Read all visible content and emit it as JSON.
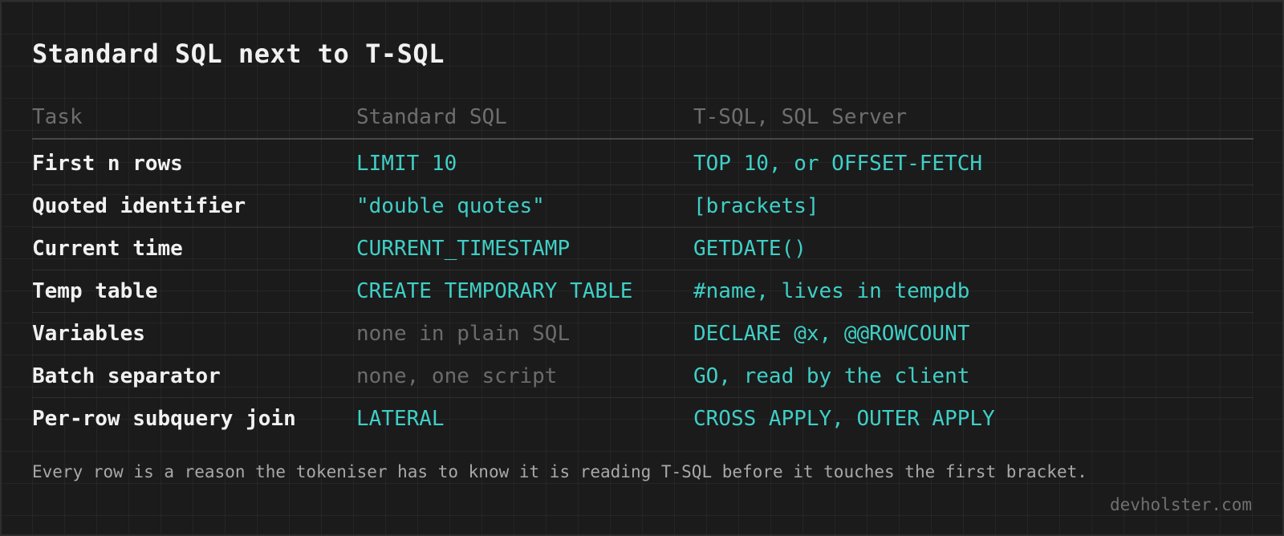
{
  "title": "Standard SQL next to T-SQL",
  "table": {
    "headers": [
      "Task",
      "Standard SQL",
      "T-SQL, SQL Server"
    ],
    "rows": [
      {
        "task": "First n rows",
        "standard": "LIMIT 10",
        "standard_is_code": true,
        "tsql": "TOP 10, or OFFSET-FETCH"
      },
      {
        "task": "Quoted identifier",
        "standard": "\"double quotes\"",
        "standard_is_code": true,
        "tsql": "[brackets]"
      },
      {
        "task": "Current time",
        "standard": "CURRENT_TIMESTAMP",
        "standard_is_code": true,
        "tsql": "GETDATE()"
      },
      {
        "task": "Temp table",
        "standard": "CREATE TEMPORARY TABLE",
        "standard_is_code": true,
        "tsql": "#name, lives in tempdb"
      },
      {
        "task": "Variables",
        "standard": "none in plain SQL",
        "standard_is_code": false,
        "tsql": "DECLARE @x, @@ROWCOUNT"
      },
      {
        "task": "Batch separator",
        "standard": "none, one script",
        "standard_is_code": false,
        "tsql": "GO, read by the client"
      },
      {
        "task": "Per-row subquery join",
        "standard": "LATERAL",
        "standard_is_code": true,
        "tsql": "CROSS APPLY, OUTER APPLY"
      }
    ]
  },
  "footnote": "Every row is a reason the tokeniser has to know it is reading T-SQL before it touches the first bracket.",
  "brand": "devholster.com",
  "colors": {
    "background": "#1b1b1b",
    "code": "#3fcfc6",
    "heading_text": "#f1f1f1",
    "muted_text": "#6b6b6b"
  }
}
